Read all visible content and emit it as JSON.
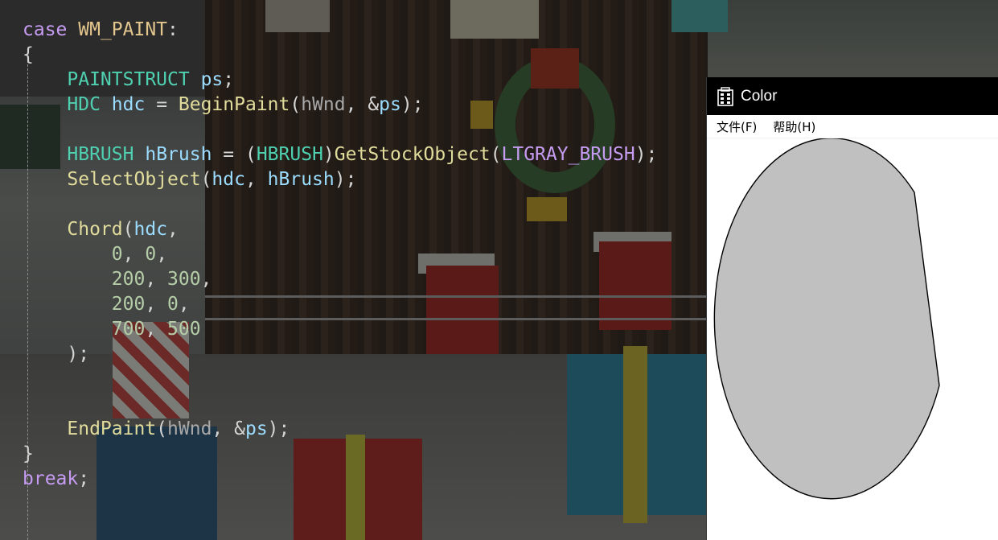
{
  "editor": {
    "lines": [
      {
        "tokens": [
          [
            "kw",
            "case"
          ],
          [
            "op",
            " "
          ],
          [
            "mac",
            "WM_PAINT"
          ],
          [
            "pun",
            ":"
          ]
        ]
      },
      {
        "tokens": [
          [
            "pun",
            "{"
          ]
        ]
      },
      {
        "tokens": [
          [
            "op",
            "    "
          ],
          [
            "ty",
            "PAINTSTRUCT"
          ],
          [
            "op",
            " "
          ],
          [
            "var",
            "ps"
          ],
          [
            "pun",
            ";"
          ]
        ]
      },
      {
        "tokens": [
          [
            "op",
            "    "
          ],
          [
            "ty",
            "HDC"
          ],
          [
            "op",
            " "
          ],
          [
            "var",
            "hdc"
          ],
          [
            "op",
            " = "
          ],
          [
            "fn",
            "BeginPaint"
          ],
          [
            "pun",
            "("
          ],
          [
            "dim",
            "hWnd"
          ],
          [
            "pun",
            ", &"
          ],
          [
            "var",
            "ps"
          ],
          [
            "pun",
            ");"
          ]
        ]
      },
      {
        "tokens": []
      },
      {
        "tokens": [
          [
            "op",
            "    "
          ],
          [
            "ty",
            "HBRUSH"
          ],
          [
            "op",
            " "
          ],
          [
            "var",
            "hBrush"
          ],
          [
            "op",
            " = ("
          ],
          [
            "ty",
            "HBRUSH"
          ],
          [
            "pun",
            ")"
          ],
          [
            "fn",
            "GetStockObject"
          ],
          [
            "pun",
            "("
          ],
          [
            "cst",
            "LTGRAY_BRUSH"
          ],
          [
            "pun",
            ");"
          ]
        ]
      },
      {
        "tokens": [
          [
            "op",
            "    "
          ],
          [
            "fn",
            "SelectObject"
          ],
          [
            "pun",
            "("
          ],
          [
            "var",
            "hdc"
          ],
          [
            "pun",
            ", "
          ],
          [
            "var",
            "hBrush"
          ],
          [
            "pun",
            ");"
          ]
        ]
      },
      {
        "tokens": []
      },
      {
        "tokens": [
          [
            "op",
            "    "
          ],
          [
            "fn",
            "Chord"
          ],
          [
            "pun",
            "("
          ],
          [
            "var",
            "hdc"
          ],
          [
            "pun",
            ","
          ]
        ]
      },
      {
        "tokens": [
          [
            "op",
            "        "
          ],
          [
            "num",
            "0"
          ],
          [
            "pun",
            ", "
          ],
          [
            "num",
            "0"
          ],
          [
            "pun",
            ","
          ]
        ]
      },
      {
        "tokens": [
          [
            "op",
            "        "
          ],
          [
            "num",
            "200"
          ],
          [
            "pun",
            ", "
          ],
          [
            "num",
            "300"
          ],
          [
            "pun",
            ","
          ]
        ]
      },
      {
        "tokens": [
          [
            "op",
            "        "
          ],
          [
            "num",
            "200"
          ],
          [
            "pun",
            ", "
          ],
          [
            "num",
            "0"
          ],
          [
            "pun",
            ","
          ]
        ]
      },
      {
        "tokens": [
          [
            "op",
            "        "
          ],
          [
            "num",
            "700"
          ],
          [
            "pun",
            ", "
          ],
          [
            "num",
            "500"
          ]
        ]
      },
      {
        "tokens": [
          [
            "op",
            "    "
          ],
          [
            "pun",
            ");"
          ]
        ]
      },
      {
        "tokens": []
      },
      {
        "tokens": []
      },
      {
        "tokens": [
          [
            "op",
            "    "
          ],
          [
            "fn",
            "EndPaint"
          ],
          [
            "pun",
            "("
          ],
          [
            "dim",
            "hWnd"
          ],
          [
            "pun",
            ", &"
          ],
          [
            "var",
            "ps"
          ],
          [
            "pun",
            ");"
          ]
        ]
      },
      {
        "tokens": [
          [
            "pun",
            "}"
          ]
        ]
      },
      {
        "tokens": [
          [
            "kw",
            "break"
          ],
          [
            "pun",
            ";"
          ]
        ]
      }
    ]
  },
  "window": {
    "title": "Color",
    "icon": "app-window-icon",
    "menu": [
      "文件(F)",
      "帮助(H)"
    ],
    "chord_fill": "#c0c0c0",
    "chord_stroke": "#000000"
  },
  "colors": {
    "keyword": "#c69cf3",
    "type": "#4fd0b0",
    "variable": "#9cdcfe",
    "function": "#e1dc9c",
    "number": "#b5cea8"
  }
}
